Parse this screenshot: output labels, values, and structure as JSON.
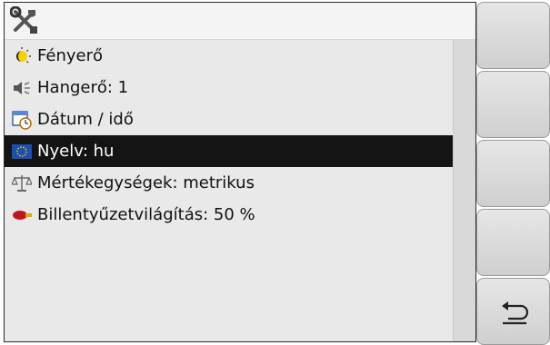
{
  "header": {
    "icon": "tools-icon"
  },
  "menu": {
    "items": [
      {
        "label": "Fényerő",
        "icon": "brightness-icon",
        "selected": false
      },
      {
        "label": "Hangerő: 1",
        "icon": "speaker-icon",
        "selected": false
      },
      {
        "label": "Dátum / idő",
        "icon": "calendar-clock-icon",
        "selected": false
      },
      {
        "label": "Nyelv: hu",
        "icon": "eu-flag-icon",
        "selected": true
      },
      {
        "label": "Mértékegységek: metrikus",
        "icon": "scale-icon",
        "selected": false
      },
      {
        "label": "Billentyűzetvilágítás:  50 %",
        "icon": "key-light-icon",
        "selected": false
      }
    ]
  },
  "softkeys": {
    "icons": [
      "",
      "",
      "",
      "",
      "back-icon"
    ]
  },
  "colors": {
    "selection_bg": "#141414",
    "selection_fg": "#ffffff",
    "list_bg": "#e9e9e9"
  }
}
